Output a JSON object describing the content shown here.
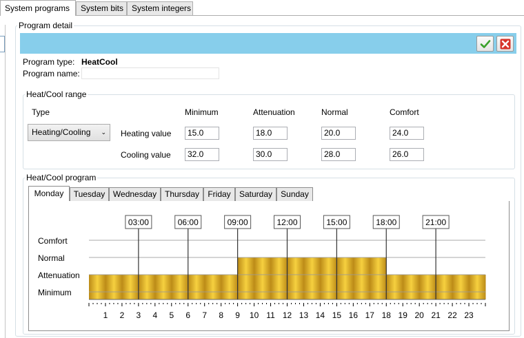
{
  "tabs": [
    {
      "label": "System programs",
      "active": true
    },
    {
      "label": "System bits",
      "active": false
    },
    {
      "label": "System integers",
      "active": false
    }
  ],
  "program_detail": {
    "title": "Program detail",
    "header_color": "#87ceeb",
    "accept_icon": "check-icon",
    "cancel_icon": "close-icon",
    "program_type_label": "Program type:",
    "program_type_value": "HeatCool",
    "program_name_label": "Program name:",
    "program_name_value": ""
  },
  "range": {
    "title": "Heat/Cool range",
    "type_label": "Type",
    "type_selected": "Heating/Cooling",
    "columns": [
      "Minimum",
      "Attenuation",
      "Normal",
      "Comfort"
    ],
    "heating_label": "Heating value",
    "cooling_label": "Cooling value",
    "heating_values": [
      "15.0",
      "18.0",
      "20.0",
      "24.0"
    ],
    "cooling_values": [
      "32.0",
      "30.0",
      "28.0",
      "26.0"
    ]
  },
  "program": {
    "title": "Heat/Cool program",
    "days": [
      "Monday",
      "Tuesday",
      "Wednesday",
      "Thursday",
      "Friday",
      "Saturday",
      "Sunday"
    ],
    "active_day": "Monday",
    "levels": [
      "Comfort",
      "Normal",
      "Attenuation",
      "Minimum"
    ],
    "markers": [
      "03:00",
      "06:00",
      "09:00",
      "12:00",
      "15:00",
      "18:00",
      "21:00"
    ],
    "hour_labels": [
      "1",
      "2",
      "3",
      "4",
      "5",
      "6",
      "7",
      "8",
      "9",
      "10",
      "11",
      "12",
      "13",
      "14",
      "15",
      "16",
      "17",
      "18",
      "19",
      "20",
      "21",
      "22",
      "23"
    ],
    "schedule": [
      {
        "from": 0,
        "to": 9,
        "level": "Attenuation"
      },
      {
        "from": 9,
        "to": 18,
        "level": "Normal"
      },
      {
        "from": 18,
        "to": 24,
        "level": "Attenuation"
      }
    ],
    "bar_color": "#e8b923"
  }
}
